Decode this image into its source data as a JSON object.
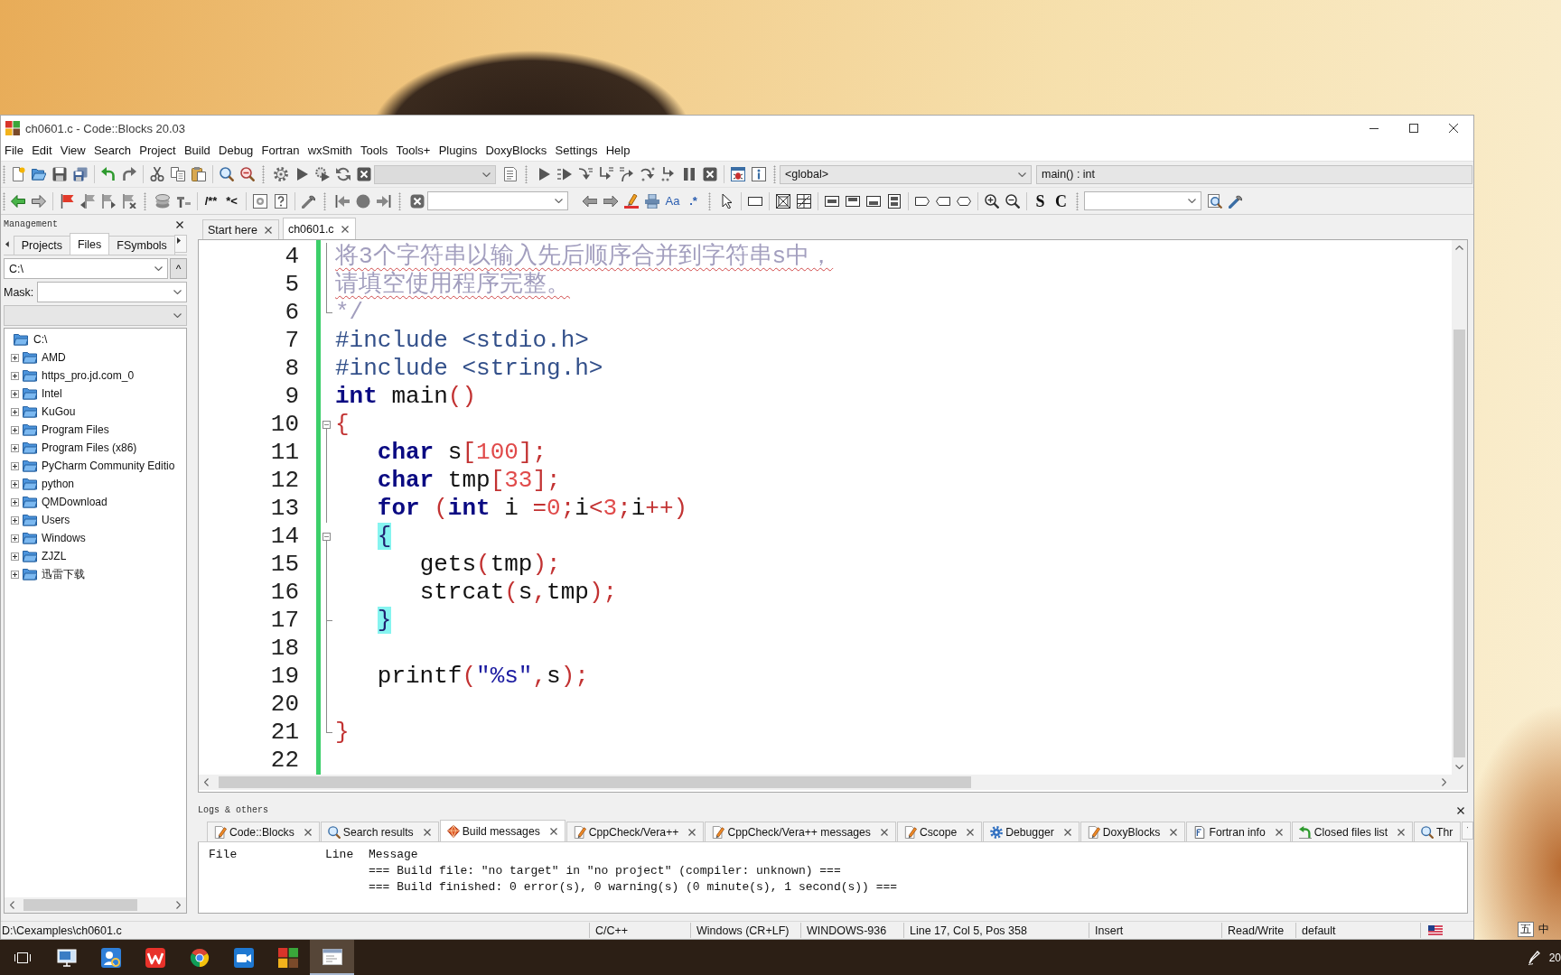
{
  "window": {
    "title": "ch0601.c - Code::Blocks 20.03"
  },
  "menu": [
    "File",
    "Edit",
    "View",
    "Search",
    "Project",
    "Build",
    "Debug",
    "Fortran",
    "wxSmith",
    "Tools",
    "Tools+",
    "Plugins",
    "DoxyBlocks",
    "Settings",
    "Help"
  ],
  "toolbar_1": {
    "target_combo": {
      "disabled": true
    },
    "scope": "<global>",
    "symbol": "main() : int"
  },
  "toolbar_2": {
    "comment_buttons": [
      "/**",
      "*<"
    ],
    "search_options": [
      "Aa",
      ".*"
    ],
    "letter_buttons": [
      "S",
      "C"
    ]
  },
  "management": {
    "title": "Management",
    "tabs": [
      {
        "label": "Projects",
        "selected": false
      },
      {
        "label": "Files",
        "selected": true
      },
      {
        "label": "FSymbols",
        "selected": false
      }
    ],
    "path": "C:\\",
    "up_button": "^",
    "mask_label": "Mask:",
    "tree": {
      "label": "C:\\",
      "children": [
        {
          "label": "AMD",
          "expanded": false
        },
        {
          "label": "https_pro.jd.com_0",
          "expanded": false
        },
        {
          "label": "Intel",
          "expanded": false
        },
        {
          "label": "KuGou",
          "expanded": false
        },
        {
          "label": "Program Files",
          "expanded": false
        },
        {
          "label": "Program Files (x86)",
          "expanded": false
        },
        {
          "label": "PyCharm Community Editio",
          "expanded": false
        },
        {
          "label": "python",
          "expanded": false
        },
        {
          "label": "QMDownload",
          "expanded": false
        },
        {
          "label": "Users",
          "expanded": false
        },
        {
          "label": "Windows",
          "expanded": false
        },
        {
          "label": "ZJZL",
          "expanded": false
        },
        {
          "label": "迅雷下载",
          "expanded": false
        }
      ]
    }
  },
  "editor": {
    "tabs": [
      {
        "label": "Start here",
        "selected": false
      },
      {
        "label": "ch0601.c",
        "selected": true
      }
    ],
    "lines": [
      {
        "number": "4",
        "fold": {
          "kind": "line"
        },
        "tokens": [
          {
            "text": "将3个字符串以输入先后顺序合并到字符串s中，",
            "kind": "comment_flagged"
          }
        ]
      },
      {
        "number": "5",
        "fold": {
          "kind": "line"
        },
        "tokens": [
          {
            "text": "请填空使用程序完整。",
            "kind": "comment_flagged"
          }
        ]
      },
      {
        "number": "6",
        "fold": {
          "kind": "end"
        },
        "tokens": [
          {
            "text": "*/",
            "kind": "comment"
          }
        ]
      },
      {
        "number": "7",
        "tokens": [
          {
            "text": "#include <stdio.h>",
            "kind": "preprocessor"
          }
        ]
      },
      {
        "number": "8",
        "tokens": [
          {
            "text": "#include <string.h>",
            "kind": "preprocessor"
          }
        ]
      },
      {
        "number": "9",
        "tokens": [
          {
            "text": "int",
            "kind": "keyword"
          },
          {
            "text": " main",
            "kind": "plain"
          },
          {
            "text": "()",
            "kind": "operator"
          }
        ]
      },
      {
        "number": "10",
        "fold": {
          "kind": "open"
        },
        "tokens": [
          {
            "text": "{",
            "kind": "operator"
          }
        ]
      },
      {
        "number": "11",
        "fold": {
          "kind": "line"
        },
        "tokens": [
          {
            "text": "   char",
            "kind": "keyword"
          },
          {
            "text": " s",
            "kind": "plain"
          },
          {
            "text": "[",
            "kind": "operator"
          },
          {
            "text": "100",
            "kind": "number"
          },
          {
            "text": "];",
            "kind": "operator"
          }
        ]
      },
      {
        "number": "12",
        "fold": {
          "kind": "line"
        },
        "tokens": [
          {
            "text": "   char",
            "kind": "keyword"
          },
          {
            "text": " tmp",
            "kind": "plain"
          },
          {
            "text": "[",
            "kind": "operator"
          },
          {
            "text": "33",
            "kind": "number"
          },
          {
            "text": "];",
            "kind": "operator"
          }
        ]
      },
      {
        "number": "13",
        "fold": {
          "kind": "line"
        },
        "tokens": [
          {
            "text": "   for",
            "kind": "keyword"
          },
          {
            "text": " (",
            "kind": "operator"
          },
          {
            "text": "int",
            "kind": "keyword"
          },
          {
            "text": " i",
            "kind": "plain"
          },
          {
            "text": " =",
            "kind": "operator"
          },
          {
            "text": "0",
            "kind": "number"
          },
          {
            "text": ";",
            "kind": "operator"
          },
          {
            "text": "i",
            "kind": "plain"
          },
          {
            "text": "<",
            "kind": "operator"
          },
          {
            "text": "3",
            "kind": "number"
          },
          {
            "text": ";",
            "kind": "operator"
          },
          {
            "text": "i",
            "kind": "plain"
          },
          {
            "text": "++)",
            "kind": "operator"
          }
        ]
      },
      {
        "number": "14",
        "fold": {
          "kind": "open"
        },
        "tokens": [
          {
            "text": "   {",
            "kind": "brace_match"
          }
        ]
      },
      {
        "number": "15",
        "fold": {
          "kind": "line"
        },
        "tokens": [
          {
            "text": "      gets",
            "kind": "plain"
          },
          {
            "text": "(",
            "kind": "operator"
          },
          {
            "text": "tmp",
            "kind": "plain"
          },
          {
            "text": ");",
            "kind": "operator"
          }
        ]
      },
      {
        "number": "16",
        "fold": {
          "kind": "line"
        },
        "tokens": [
          {
            "text": "      strcat",
            "kind": "plain"
          },
          {
            "text": "(",
            "kind": "operator"
          },
          {
            "text": "s",
            "kind": "plain"
          },
          {
            "text": ",",
            "kind": "operator"
          },
          {
            "text": "tmp",
            "kind": "plain"
          },
          {
            "text": ");",
            "kind": "operator"
          }
        ]
      },
      {
        "number": "17",
        "fold": {
          "kind": "tee"
        },
        "tokens": [
          {
            "text": "   }",
            "kind": "brace_match"
          }
        ]
      },
      {
        "number": "18",
        "fold": {
          "kind": "line"
        }
      },
      {
        "number": "19",
        "fold": {
          "kind": "line"
        },
        "tokens": [
          {
            "text": "   printf",
            "kind": "plain"
          },
          {
            "text": "(",
            "kind": "operator"
          },
          {
            "text": "\"%s\"",
            "kind": "string"
          },
          {
            "text": ",",
            "kind": "operator"
          },
          {
            "text": "s",
            "kind": "plain"
          },
          {
            "text": ");",
            "kind": "operator"
          }
        ]
      },
      {
        "number": "20",
        "fold": {
          "kind": "line"
        }
      },
      {
        "number": "21",
        "fold": {
          "kind": "end"
        },
        "tokens": [
          {
            "text": "}",
            "kind": "operator"
          }
        ]
      },
      {
        "number": "22"
      }
    ]
  },
  "logs": {
    "title": "Logs & others",
    "tabs": [
      {
        "label": "Code::Blocks",
        "kind": "log",
        "selected": false
      },
      {
        "label": "Search results",
        "kind": "search",
        "selected": false
      },
      {
        "label": "Build messages",
        "kind": "build",
        "selected": true
      },
      {
        "label": "CppCheck/Vera++",
        "kind": "log",
        "selected": false
      },
      {
        "label": "CppCheck/Vera++ messages",
        "kind": "log",
        "selected": false
      },
      {
        "label": "Cscope",
        "kind": "log",
        "selected": false
      },
      {
        "label": "Debugger",
        "kind": "debugger",
        "selected": false
      },
      {
        "label": "DoxyBlocks",
        "kind": "log",
        "selected": false
      },
      {
        "label": "Fortran info",
        "kind": "info",
        "selected": false
      },
      {
        "label": "Closed files list",
        "kind": "files",
        "selected": false
      },
      {
        "label": "Thr",
        "kind": "search",
        "selected": false
      }
    ],
    "columns": [
      "File",
      "Line",
      "Message"
    ],
    "messages": [
      "=== Build file: \"no target\" in \"no project\" (compiler: unknown) ===",
      "=== Build finished: 0 error(s), 0 warning(s) (0 minute(s), 1 second(s)) ==="
    ]
  },
  "status_bar": {
    "file": "D:\\Cexamples\\ch0601.c",
    "fields": [
      "C/C++",
      "Windows (CR+LF)",
      "WINDOWS-936",
      "Line 17, Col 5, Pos 358",
      "Insert",
      "Read/Write",
      "default"
    ]
  },
  "ime": [
    "五",
    "中"
  ],
  "taskbar": {
    "buttons": [
      {
        "kind": "task_view",
        "selected": false
      },
      {
        "kind": "monitor",
        "selected": false
      },
      {
        "kind": "photo",
        "selected": false
      },
      {
        "kind": "zigzag",
        "selected": false
      },
      {
        "kind": "tricolor",
        "selected": false
      },
      {
        "kind": "camera",
        "selected": false
      },
      {
        "kind": "blocks",
        "selected": false
      },
      {
        "kind": "window",
        "selected": true
      }
    ],
    "clock": "20"
  }
}
